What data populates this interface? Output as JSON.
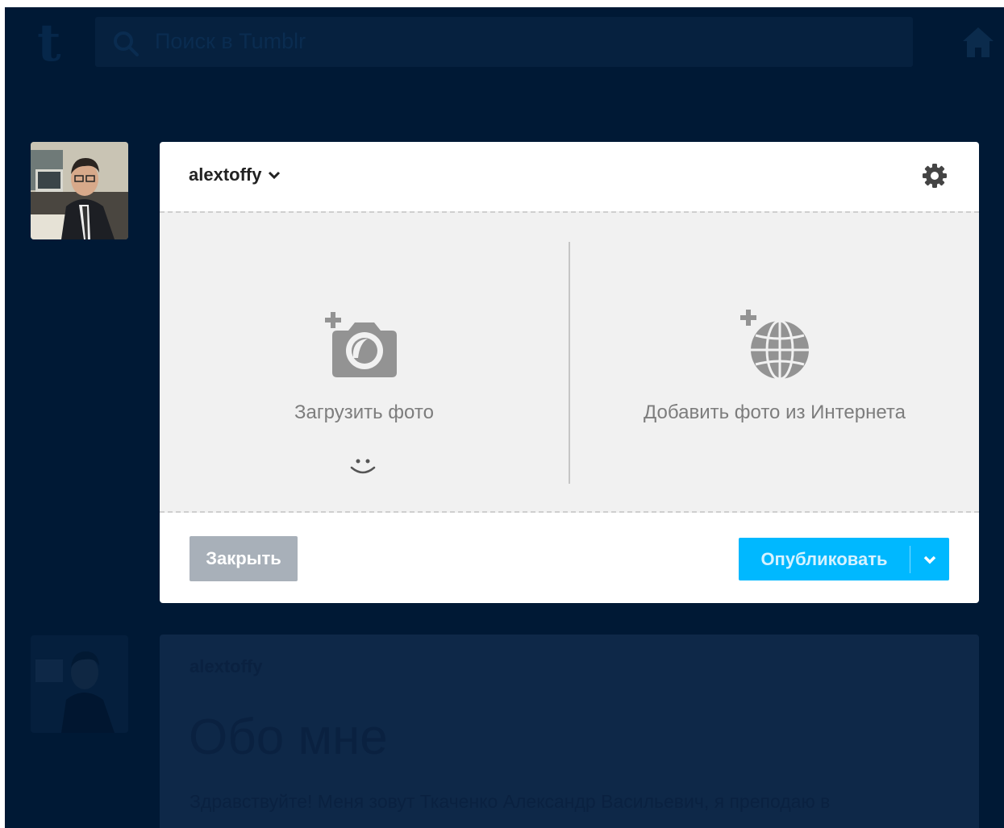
{
  "header": {
    "logo_letter": "t",
    "search_placeholder": "Поиск в Tumblr"
  },
  "composer": {
    "blog_name": "alextoffy",
    "upload_photo_label": "Загрузить фото",
    "add_from_web_label": "Добавить фото из Интернета",
    "close_label": "Закрыть",
    "publish_label": "Опубликовать"
  },
  "post": {
    "author": "alextoffy",
    "title": "Обо мне",
    "text": "Здравствуйте! Меня зовут Ткаченко Александр Васильевич, я преподаю в"
  },
  "icons": {
    "search": "search-icon",
    "home": "home-icon",
    "settings": "gear-icon",
    "upload": "camera-plus-icon",
    "web": "globe-plus-icon",
    "emoji": "smiley-icon",
    "dropdown": "chevron-down-icon"
  },
  "colors": {
    "background": "#001935",
    "publish": "#00b8ff",
    "close": "#a8b0b9",
    "upload_area": "#f1f1f1"
  }
}
